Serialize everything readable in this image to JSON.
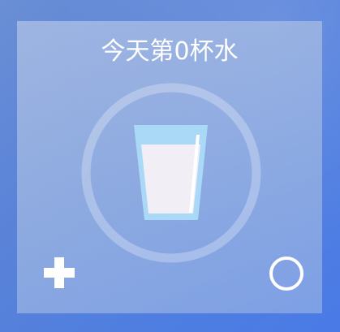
{
  "widget": {
    "title": "今天第0杯水",
    "cups_today": 0
  },
  "icons": {
    "glass": "water-glass-icon",
    "add": "plus-icon",
    "ring": "circle-icon"
  },
  "colors": {
    "background": "#5a83d8",
    "glass": "#a9d9f7",
    "water": "#f3eef7",
    "text": "#ffffff"
  }
}
